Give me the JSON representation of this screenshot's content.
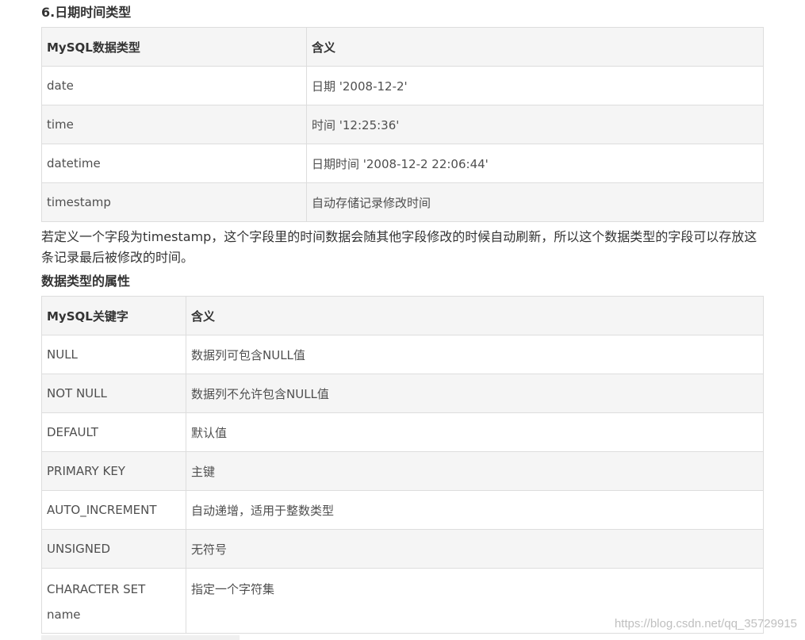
{
  "section1": {
    "heading": "6.日期时间类型",
    "table": {
      "headers": [
        "MySQL数据类型",
        "含义"
      ],
      "rows": [
        [
          "date",
          "日期 '2008-12-2'"
        ],
        [
          "time",
          "时间 '12:25:36'"
        ],
        [
          "datetime",
          "日期时间 '2008-12-2 22:06:44'"
        ],
        [
          "timestamp",
          "自动存储记录修改时间"
        ]
      ]
    },
    "note": "若定义一个字段为timestamp，这个字段里的时间数据会随其他字段修改的时候自动刷新，所以这个数据类型的字段可以存放这条记录最后被修改的时间。"
  },
  "section2": {
    "heading": "数据类型的属性",
    "table": {
      "headers": [
        "MySQL关键字",
        "含义"
      ],
      "rows": [
        [
          "NULL",
          "数据列可包含NULL值"
        ],
        [
          "NOT NULL",
          "数据列不允许包含NULL值"
        ],
        [
          "DEFAULT",
          "默认值"
        ],
        [
          "PRIMARY KEY",
          "主键"
        ],
        [
          "AUTO_INCREMENT",
          "自动递增，适用于整数类型"
        ],
        [
          "UNSIGNED",
          "无符号"
        ],
        [
          "CHARACTER SET name",
          "指定一个字符集"
        ]
      ]
    }
  },
  "watermark": "https://blog.csdn.net/qq_35729915"
}
